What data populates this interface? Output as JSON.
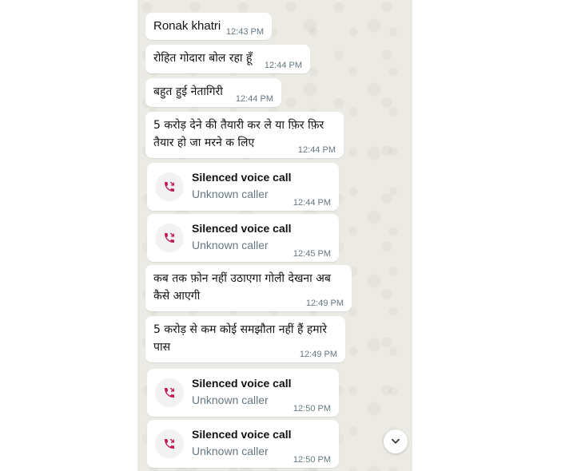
{
  "messages": [
    {
      "text": "Ronak khatri",
      "time": "12:43 PM"
    },
    {
      "text": "रोहित गोदारा बोल रहा हूँ",
      "time": "12:44 PM"
    },
    {
      "text": "बहुत हुई नेतागिरी",
      "time": "12:44 PM"
    },
    {
      "text": "5 करोड़ देने की तैयारी कर ले या फ़िर फ़िर तैयार हो जा मरने क लिए",
      "time": "12:44 PM"
    },
    {
      "text": "कब तक फ़ोन नहीं उठाएगा गोली देखना अब कैसे आएगी",
      "time": "12:49 PM"
    },
    {
      "text": "5 करोड़ से कम कोई समझौता नहीं हैं हमारे पास",
      "time": "12:49 PM"
    }
  ],
  "calls": [
    {
      "title": "Silenced voice call",
      "subtitle": "Unknown caller",
      "time": "12:44 PM"
    },
    {
      "title": "Silenced voice call",
      "subtitle": "Unknown caller",
      "time": "12:45 PM"
    },
    {
      "title": "Silenced voice call",
      "subtitle": "Unknown caller",
      "time": "12:50 PM"
    },
    {
      "title": "Silenced voice call",
      "subtitle": "Unknown caller",
      "time": "12:50 PM"
    }
  ],
  "icons": {
    "call": "missed-call-icon",
    "scroll": "chevron-down-icon",
    "call_color": "#c2185b"
  }
}
